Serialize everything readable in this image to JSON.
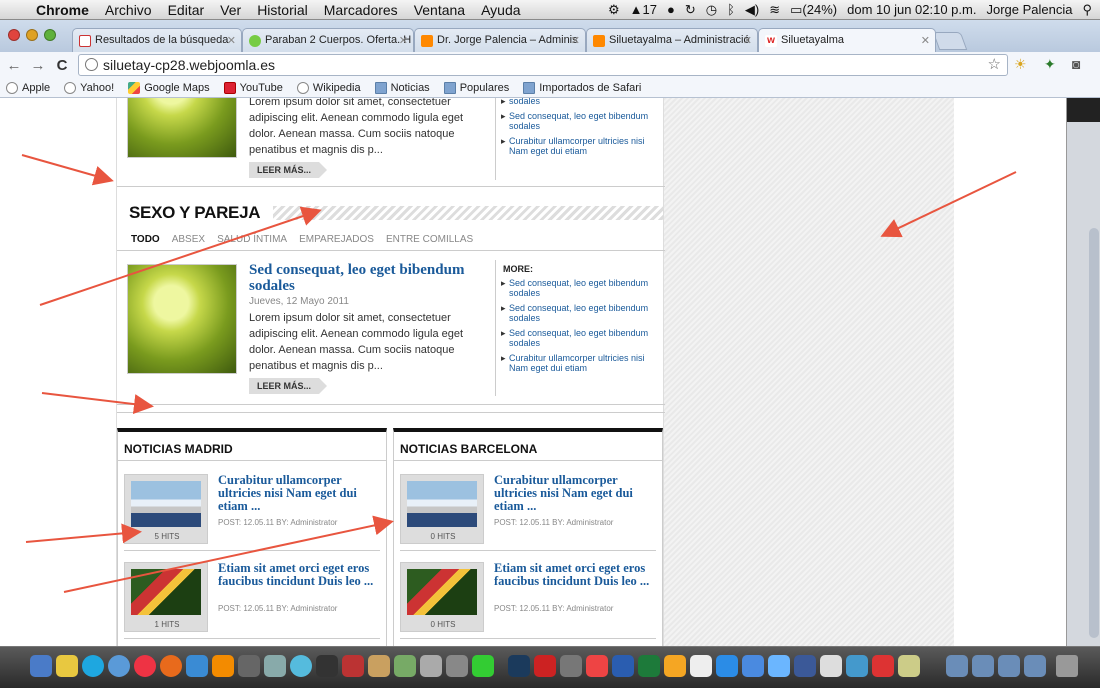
{
  "menubar": {
    "app": "Chrome",
    "items": [
      "Archivo",
      "Editar",
      "Ver",
      "Historial",
      "Marcadores",
      "Ventana",
      "Ayuda"
    ],
    "status": {
      "adobe_count": "17",
      "battery": "(24%)",
      "datetime": "dom 10 jun  02:10 p.m.",
      "user": "Jorge Palencia"
    }
  },
  "tabs": [
    {
      "label": "Resultados de la búsqueda",
      "icon": "gmail-icon",
      "active": false
    },
    {
      "label": "Paraban 2 Cuerpos. Oferta. H",
      "icon": "eye-icon",
      "active": false
    },
    {
      "label": "Dr. Jorge Palencia – Adminis",
      "icon": "joomla-icon",
      "active": false
    },
    {
      "label": "Siluetayalma – Administració",
      "icon": "joomla-icon",
      "active": false
    },
    {
      "label": "Siluetayalma",
      "icon": "w-icon",
      "active": true
    }
  ],
  "omnibox": {
    "url": "siluetay-cp28.webjoomla.es"
  },
  "bookmarks": [
    {
      "label": "Apple",
      "icon": "globe"
    },
    {
      "label": "Yahoo!",
      "icon": "globe"
    },
    {
      "label": "Google Maps",
      "icon": "gmaps"
    },
    {
      "label": "YouTube",
      "icon": "youtube"
    },
    {
      "label": "Wikipedia",
      "icon": "globe"
    },
    {
      "label": "Noticias",
      "icon": "folder"
    },
    {
      "label": "Populares",
      "icon": "folder"
    },
    {
      "label": "Importados de Safari",
      "icon": "folder"
    }
  ],
  "top_block": {
    "body": "Lorem ipsum dolor sit amet, consectetuer adipiscing elit. Aenean commodo ligula eget dolor. Aenean massa. Cum sociis natoque penatibus et magnis dis p...",
    "leer": "LEER MÁS...",
    "more_items": [
      "sodales",
      "Sed consequat, leo eget bibendum sodales",
      "Curabitur ullamcorper ultricies nisi Nam eget dui etiam"
    ]
  },
  "section": {
    "title": "SEXO Y PAREJA",
    "subnav": [
      "TODO",
      "ABSEX",
      "SALUD ÍNTIMA",
      "EMPAREJADOS",
      "ENTRE COMILLAS"
    ],
    "article": {
      "title": "Sed consequat, leo eget bibendum sodales",
      "date": "Jueves, 12 Mayo 2011",
      "body": "Lorem ipsum dolor sit amet, consectetuer adipiscing elit. Aenean commodo ligula eget dolor. Aenean massa. Cum sociis natoque penatibus et magnis dis p...",
      "leer": "LEER MÁS..."
    },
    "more_label": "MORE:",
    "more_items": [
      "Sed consequat, leo eget bibendum sodales",
      "Sed consequat, leo eget bibendum sodales",
      "Sed consequat, leo eget bibendum sodales",
      "Curabitur ullamcorper ultricies nisi Nam eget dui etiam"
    ]
  },
  "madrid": {
    "title": "NOTICIAS MADRID",
    "items": [
      {
        "title": "Curabitur ullamcorper ultricies nisi Nam eget dui etiam ...",
        "hits": "5 HITS",
        "meta": "POST: 12.05.11 BY: Administrator",
        "thumb": "cyclist"
      },
      {
        "title": "Etiam sit amet orci eget eros faucibus tincidunt Duis leo ...",
        "hits": "1 HITS",
        "meta": "POST: 12.05.11 BY: Administrator",
        "thumb": "soccer"
      }
    ]
  },
  "barcelona": {
    "title": "NOTICIAS BARCELONA",
    "items": [
      {
        "title": "Curabitur ullamcorper ultricies nisi Nam eget dui etiam ...",
        "hits": "0 HITS",
        "meta": "POST: 12.05.11 BY: Administrator",
        "thumb": "cyclist"
      },
      {
        "title": "Etiam sit amet orci eget eros faucibus tincidunt Duis leo ...",
        "hits": "0 HITS",
        "meta": "POST: 12.05.11 BY: Administrator",
        "thumb": "soccer"
      }
    ]
  },
  "colors": {
    "link": "#1a5a9a",
    "arrow": "#e8553f"
  }
}
